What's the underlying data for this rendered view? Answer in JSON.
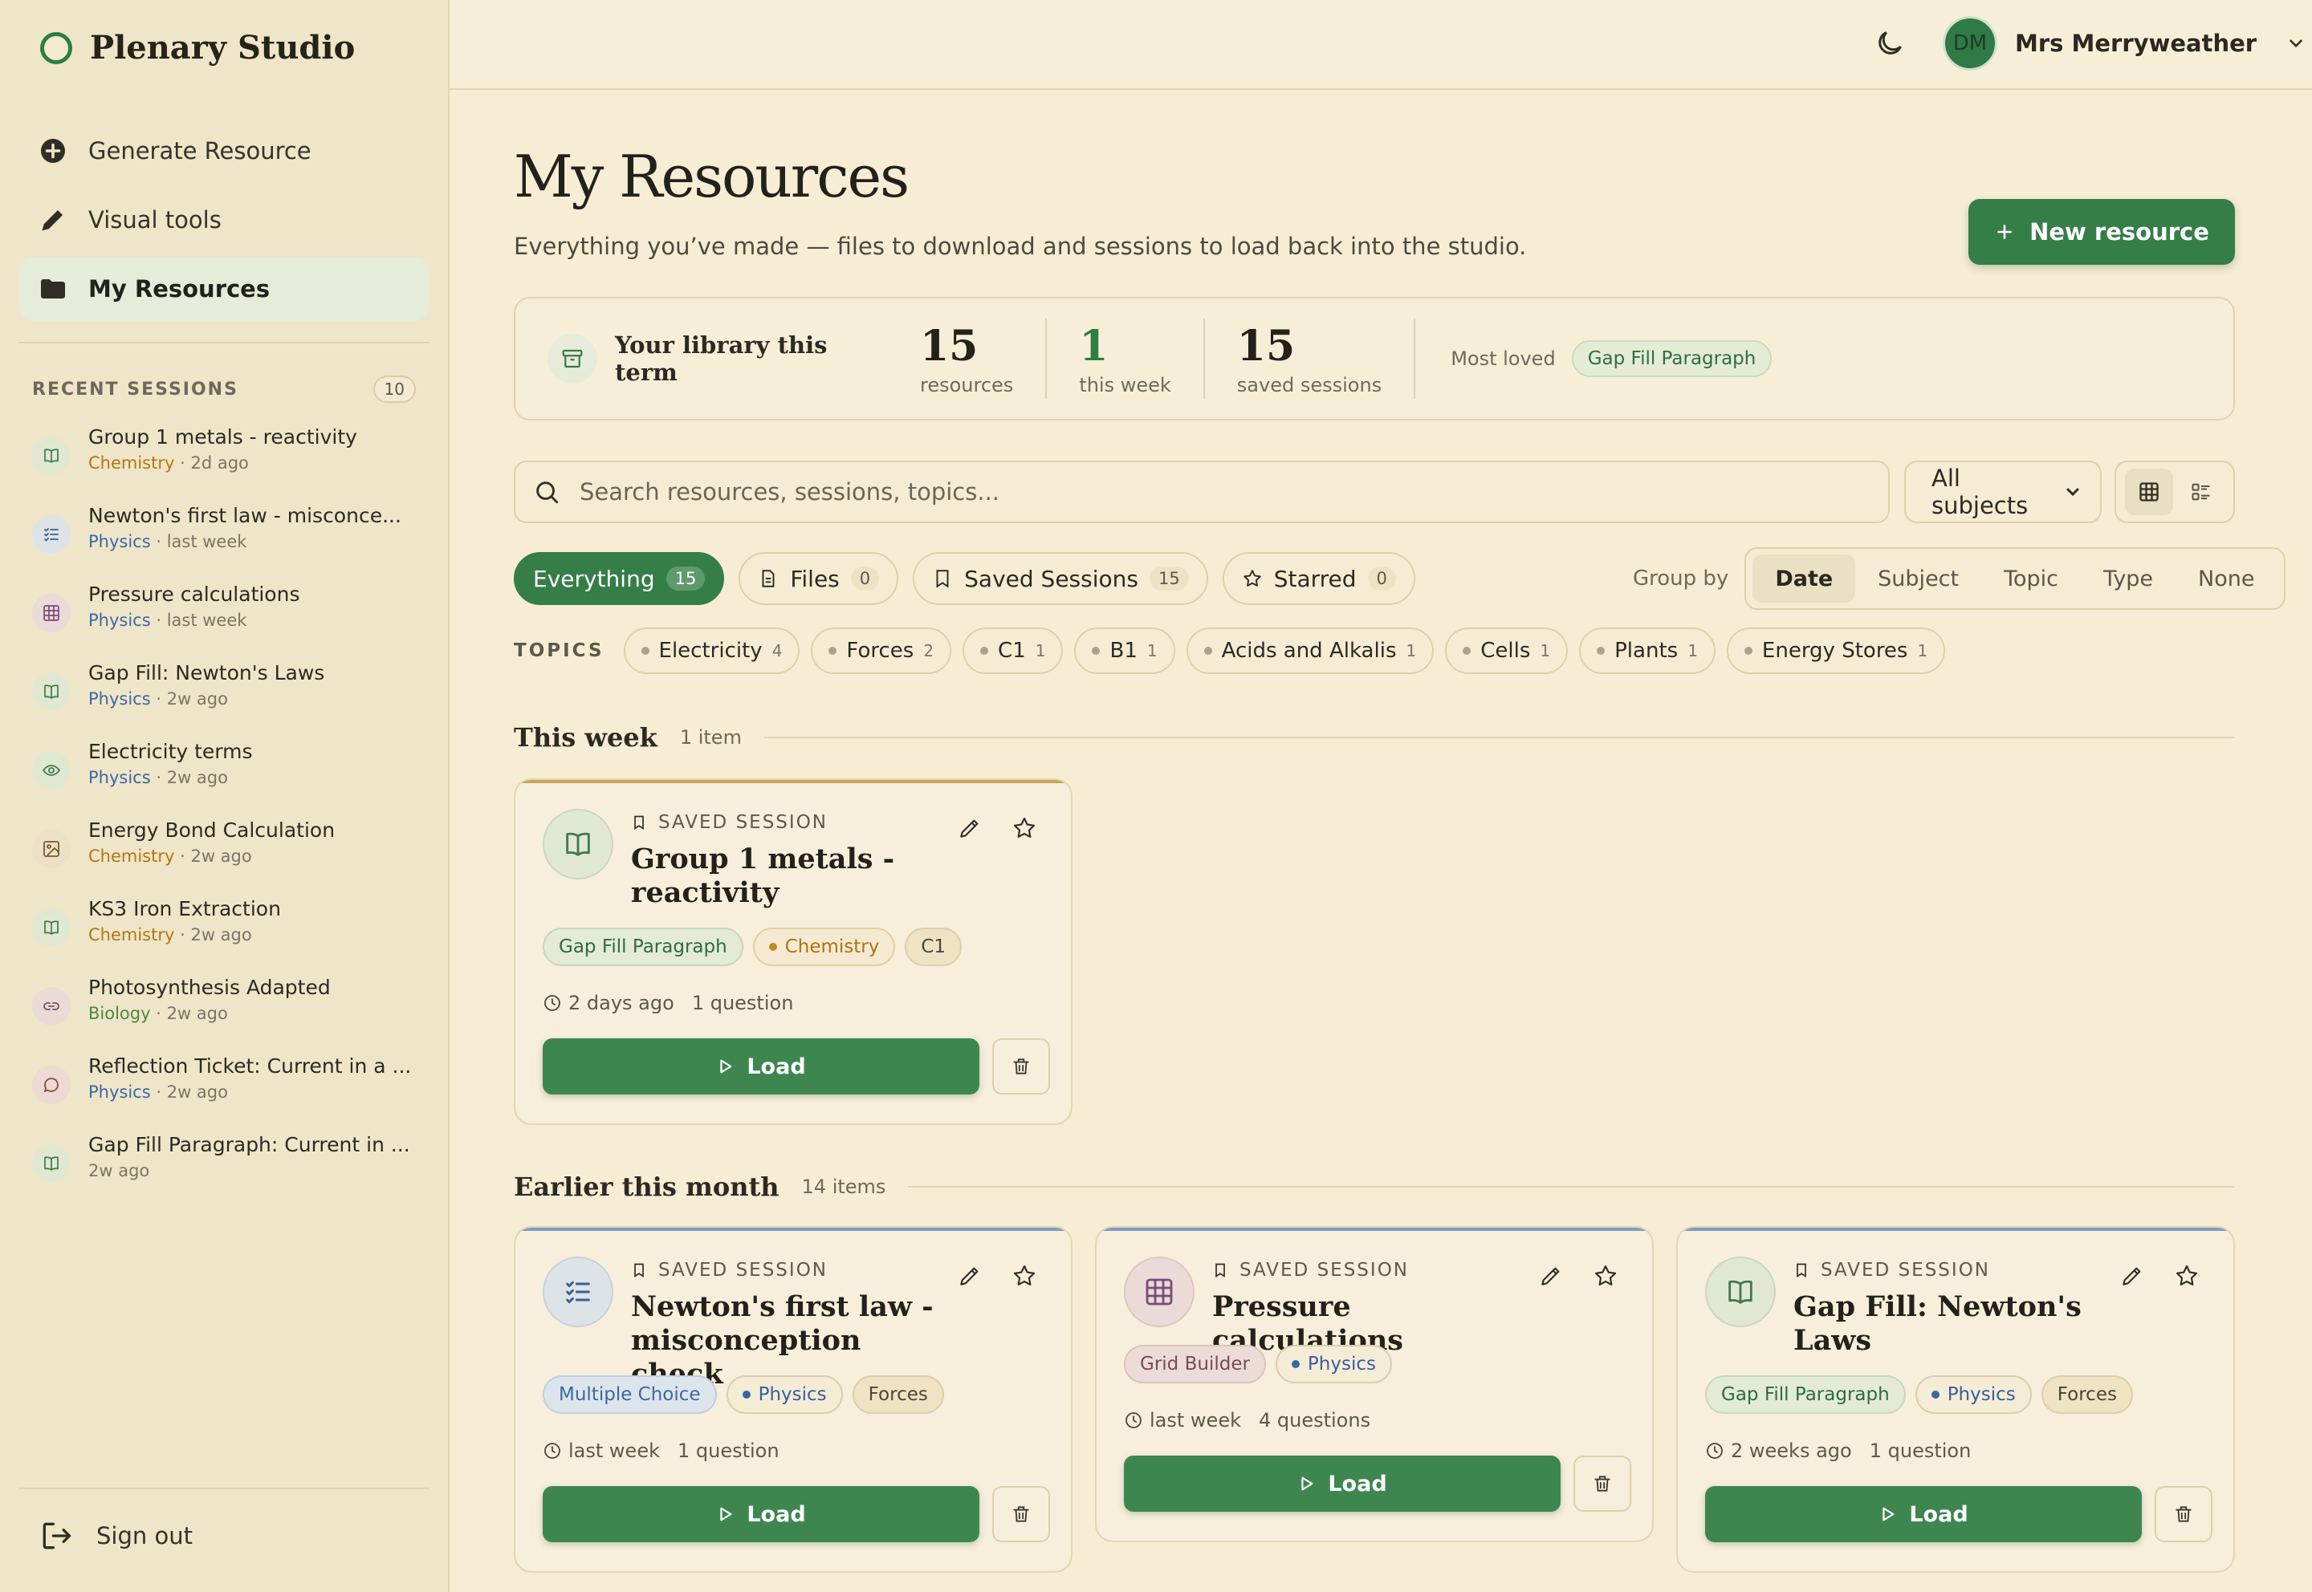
{
  "brand": {
    "name": "Plenary Studio"
  },
  "nav": [
    {
      "label": "Generate Resource",
      "icon": "plus-circle-icon"
    },
    {
      "label": "Visual tools",
      "icon": "pencil-icon"
    },
    {
      "label": "My Resources",
      "icon": "folder-icon",
      "active": true
    }
  ],
  "recent": {
    "label": "RECENT SESSIONS",
    "count": "10",
    "items": [
      {
        "title": "Group 1 metals - reactivity",
        "subject": "Chemistry",
        "time": "2d ago",
        "icon": "book-icon"
      },
      {
        "title": "Newton's first law - misconce...",
        "subject": "Physics",
        "time": "last week",
        "icon": "checklist-icon"
      },
      {
        "title": "Pressure calculations",
        "subject": "Physics",
        "time": "last week",
        "icon": "grid-icon"
      },
      {
        "title": "Gap Fill: Newton's Laws",
        "subject": "Physics",
        "time": "2w ago",
        "icon": "book-icon"
      },
      {
        "title": "Electricity terms",
        "subject": "Physics",
        "time": "2w ago",
        "icon": "eye-icon"
      },
      {
        "title": "Energy Bond Calculation",
        "subject": "Chemistry",
        "time": "2w ago",
        "icon": "image-icon"
      },
      {
        "title": "KS3 Iron Extraction",
        "subject": "Chemistry",
        "time": "2w ago",
        "icon": "book-icon"
      },
      {
        "title": "Photosynthesis Adapted",
        "subject": "Biology",
        "time": "2w ago",
        "icon": "link-icon"
      },
      {
        "title": "Reflection Ticket: Current in a ...",
        "subject": "Physics",
        "time": "2w ago",
        "icon": "chat-icon"
      },
      {
        "title": "Gap Fill Paragraph: Current in ...",
        "subject": "",
        "time": "2w ago",
        "icon": "book-icon"
      }
    ]
  },
  "signout": "Sign out",
  "user": {
    "initials": "DM",
    "name": "Mrs Merryweather"
  },
  "page": {
    "title": "My Resources",
    "subtitle": "Everything you’ve made — files to download and sessions to load back into the studio.",
    "new_button": "New resource"
  },
  "stats": {
    "label": "Your library this term",
    "items": [
      {
        "value": "15",
        "label": "resources"
      },
      {
        "value": "1",
        "label": "this week"
      },
      {
        "value": "15",
        "label": "saved sessions"
      }
    ],
    "loved_label": "Most loved",
    "loved_value": "Gap Fill Paragraph"
  },
  "search": {
    "placeholder": "Search resources, sessions, topics..."
  },
  "subject_filter": {
    "selected": "All subjects"
  },
  "filters": [
    {
      "label": "Everything",
      "count": "15",
      "active": true
    },
    {
      "label": "Files",
      "count": "0"
    },
    {
      "label": "Saved Sessions",
      "count": "15"
    },
    {
      "label": "Starred",
      "count": "0"
    }
  ],
  "groupby": {
    "label": "Group by",
    "options": [
      "Date",
      "Subject",
      "Topic",
      "Type",
      "None"
    ],
    "selected": "Date"
  },
  "topics": {
    "label": "TOPICS",
    "items": [
      {
        "label": "Electricity",
        "count": "4"
      },
      {
        "label": "Forces",
        "count": "2"
      },
      {
        "label": "C1",
        "count": "1"
      },
      {
        "label": "B1",
        "count": "1"
      },
      {
        "label": "Acids and Alkalis",
        "count": "1"
      },
      {
        "label": "Cells",
        "count": "1"
      },
      {
        "label": "Plants",
        "count": "1"
      },
      {
        "label": "Energy Stores",
        "count": "1"
      }
    ]
  },
  "sections": [
    {
      "title": "This week",
      "count": "1 item",
      "cards": [
        {
          "kind": "SAVED SESSION",
          "title": "Group 1 metals - reactivity",
          "tags": [
            "Gap Fill Paragraph",
            "Chemistry",
            "C1"
          ],
          "time": "2 days ago",
          "questions": "1 question",
          "load": "Load",
          "accent": "#c9a45a"
        }
      ]
    },
    {
      "title": "Earlier this month",
      "count": "14 items",
      "cards": [
        {
          "kind": "SAVED SESSION",
          "title": "Newton's first law - misconception check",
          "tags": [
            "Multiple Choice",
            "Physics",
            "Forces"
          ],
          "time": "last week",
          "questions": "1 question",
          "load": "Load",
          "accent": "#7d9cc4"
        },
        {
          "kind": "SAVED SESSION",
          "title": "Pressure calculations",
          "tags": [
            "Grid Builder",
            "Physics"
          ],
          "time": "last week",
          "questions": "4 questions",
          "load": "Load",
          "accent": "#7d9cc4"
        },
        {
          "kind": "SAVED SESSION",
          "title": "Gap Fill: Newton's Laws",
          "tags": [
            "Gap Fill Paragraph",
            "Physics",
            "Forces"
          ],
          "time": "2 weeks ago",
          "questions": "1 question",
          "load": "Load",
          "accent": "#7d9cc4"
        }
      ]
    }
  ],
  "colors": {
    "primary": "#357e48",
    "chemistry": "#b37712",
    "physics": "#3a68a8",
    "biology": "#4b8a3e",
    "background": "#f6edd4"
  }
}
